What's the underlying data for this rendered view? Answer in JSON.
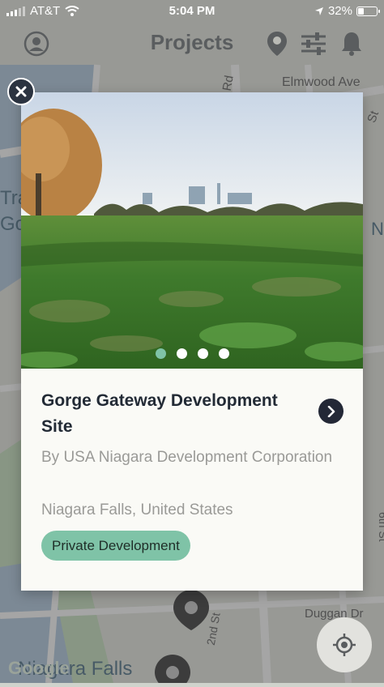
{
  "status_bar": {
    "carrier": "AT&T",
    "time": "5:04 PM",
    "battery": "32%",
    "battery_level": 0.32
  },
  "header": {
    "title": "Projects"
  },
  "icons": {
    "profile": "profile-icon",
    "pin": "map-pin-icon",
    "filter": "filter-sliders-icon",
    "bell": "bell-icon",
    "close": "close-icon",
    "chevron": "chevron-right-icon",
    "locate": "locate-crosshair-icon"
  },
  "map": {
    "labels": [
      "Elmwood Ave",
      "Rd",
      "Tra",
      "Gol",
      "6th St",
      "2nd St",
      "Duggan Dr",
      "Niagara Falls",
      "St",
      "N"
    ],
    "google_mark": "Google"
  },
  "card": {
    "project_name": "Gorge Gateway Development Site",
    "developer": "By USA Niagara Development Corporation",
    "location": "Niagara Falls, United States",
    "tag": "Private Development",
    "carousel": {
      "count": 4,
      "active_index": 0
    }
  },
  "colors": {
    "accent": "#7fc3a7",
    "dark": "#232836",
    "muted_text": "#9a9a97"
  }
}
